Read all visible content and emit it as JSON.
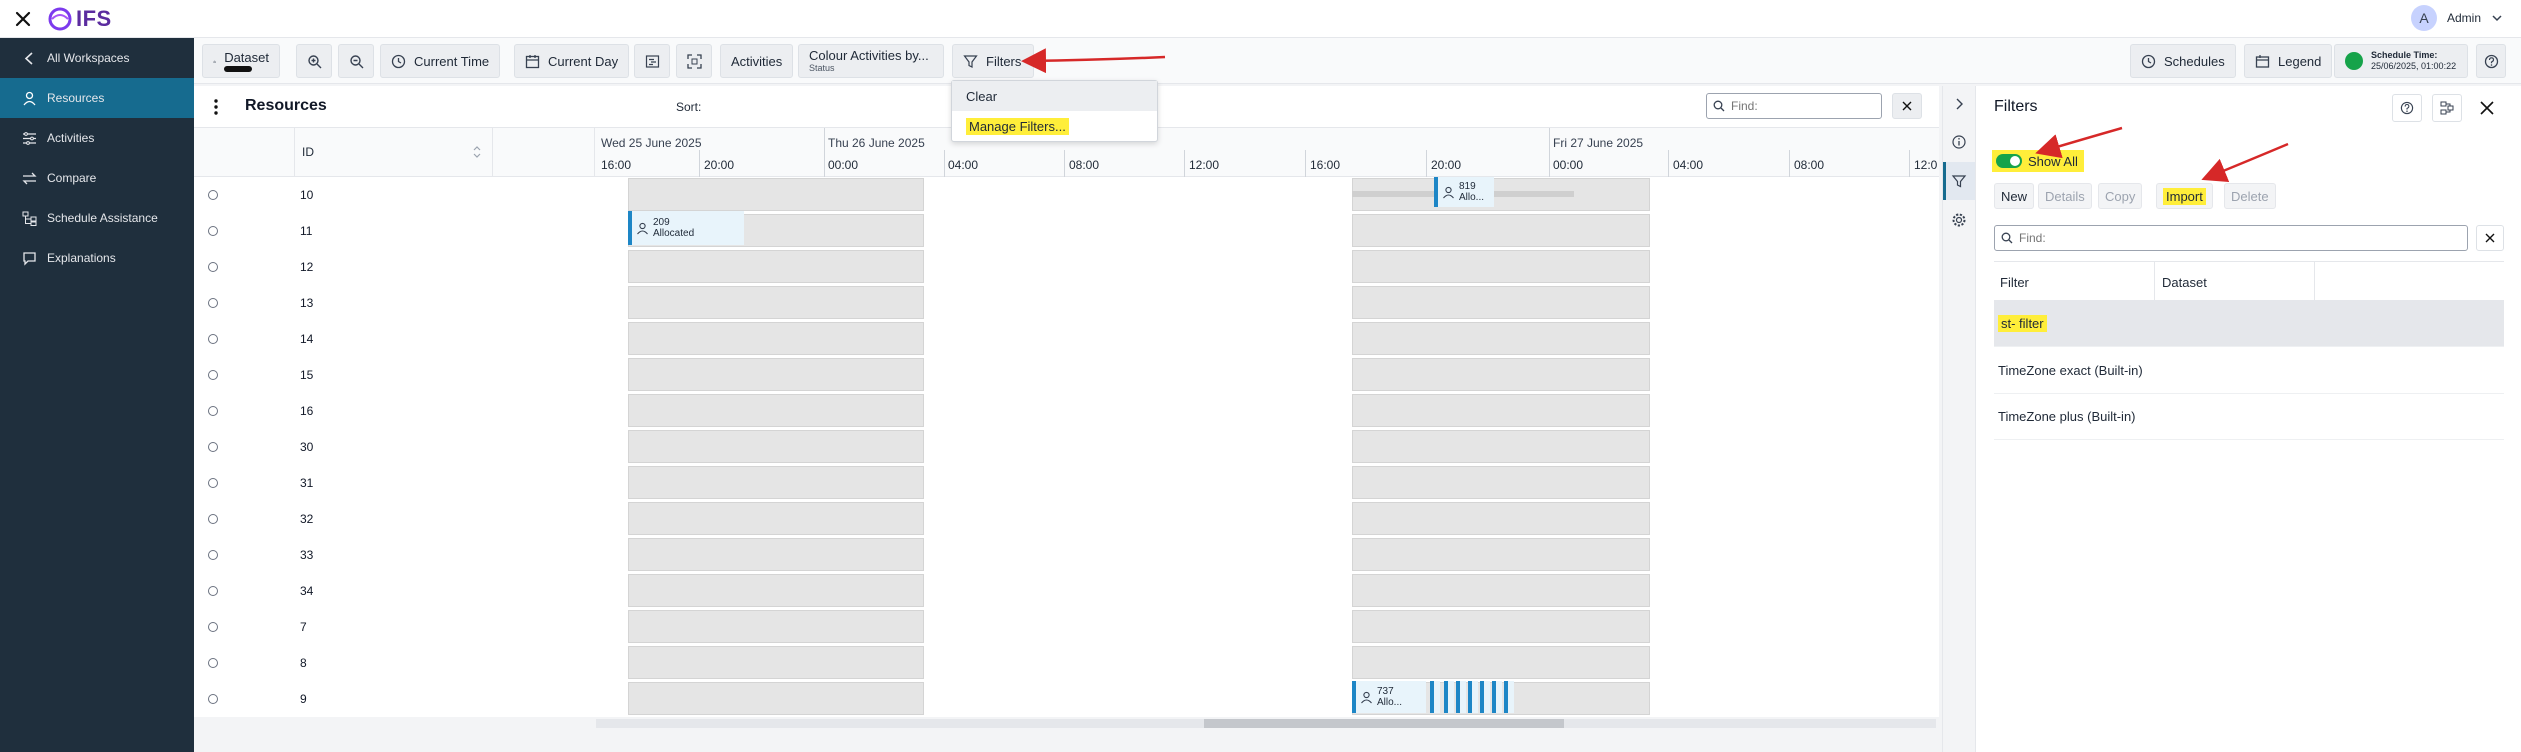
{
  "app": {
    "logo": "IFS"
  },
  "user": {
    "initial": "A",
    "name": "Admin"
  },
  "sidebar": {
    "back": "All Workspaces",
    "items": [
      {
        "label": "Resources",
        "icon": "person-icon",
        "active": true
      },
      {
        "label": "Activities",
        "icon": "list-icon"
      },
      {
        "label": "Compare",
        "icon": "compare-icon"
      },
      {
        "label": "Schedule Assistance",
        "icon": "tree-icon"
      },
      {
        "label": "Explanations",
        "icon": "chat-icon"
      }
    ]
  },
  "toolbar": {
    "dataset": "Dataset",
    "current_time": "Current Time",
    "current_day": "Current Day",
    "activities": "Activities",
    "colour_by": "Colour Activities by...",
    "colour_by_sub": "Status",
    "filters": "Filters",
    "schedules": "Schedules",
    "legend": "Legend",
    "schedule_time_label": "Schedule Time:",
    "schedule_time_value": "25/06/2025, 01:00:22"
  },
  "filters_dropdown": {
    "clear": "Clear",
    "manage": "Manage Filters..."
  },
  "resources": {
    "title": "Resources",
    "sort_label": "Sort:",
    "find_placeholder": "Find:",
    "id_header": "ID",
    "rows": [
      "10",
      "11",
      "12",
      "13",
      "14",
      "15",
      "16",
      "30",
      "31",
      "32",
      "33",
      "34",
      "7",
      "8",
      "9"
    ]
  },
  "timeline": {
    "days": [
      "Wed 25 June 2025",
      "Thu 26 June 2025",
      "Fri 27 June 2025"
    ],
    "ticks": [
      "16:00",
      "20:00",
      "00:00",
      "04:00",
      "08:00",
      "12:00",
      "16:00",
      "20:00",
      "00:00",
      "04:00",
      "08:00",
      "12:0"
    ],
    "bars": [
      {
        "id": "209",
        "status": "Allocated"
      },
      {
        "id": "819",
        "status": "Allo..."
      },
      {
        "id": "737",
        "status": "Allo..."
      }
    ]
  },
  "filters_panel": {
    "title": "Filters",
    "show_all": "Show All",
    "buttons": {
      "new": "New",
      "details": "Details",
      "copy": "Copy",
      "import": "Import",
      "delete": "Delete"
    },
    "find_placeholder": "Find:",
    "columns": {
      "filter": "Filter",
      "dataset": "Dataset"
    },
    "rows": [
      "st- filter",
      "TimeZone exact (Built-in)",
      "TimeZone plus (Built-in)"
    ]
  },
  "colors": {
    "accent": "#166b8f",
    "sidebar": "#1f2f3d",
    "highlight": "#ffee3a",
    "arrow": "#d62828",
    "bar": "#1d86c6",
    "toggle": "#16a34a"
  }
}
